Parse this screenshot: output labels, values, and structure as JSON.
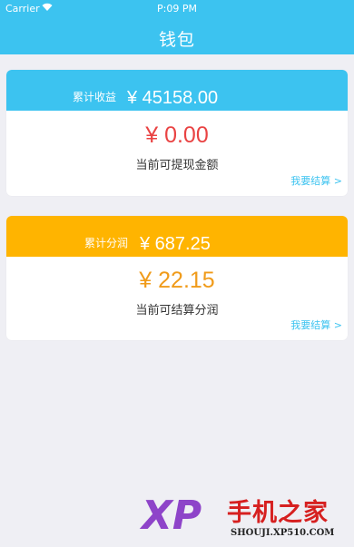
{
  "status_bar": {
    "carrier": "Carrier",
    "wifi_icon": "wifi-icon",
    "time": "P:09 PM"
  },
  "header": {
    "title": "钱包"
  },
  "income_card": {
    "label": "累计收益",
    "total": "¥ 45158.00",
    "amount": "¥ 0.00",
    "amount_label": "当前可提现金额",
    "link": "我要结算 >",
    "head_color": "#3cc3f0",
    "amount_color": "#e94343"
  },
  "profit_card": {
    "label": "累计分润",
    "total": "¥ 687.25",
    "amount": "¥ 22.15",
    "amount_label": "当前可结算分润",
    "link": "我要结算 >",
    "head_color": "#ffb400",
    "amount_color": "#f09b1a"
  },
  "watermark": {
    "xp": "XP",
    "text": "手机之家",
    "url": "SHOUJI.XP510.COM"
  }
}
